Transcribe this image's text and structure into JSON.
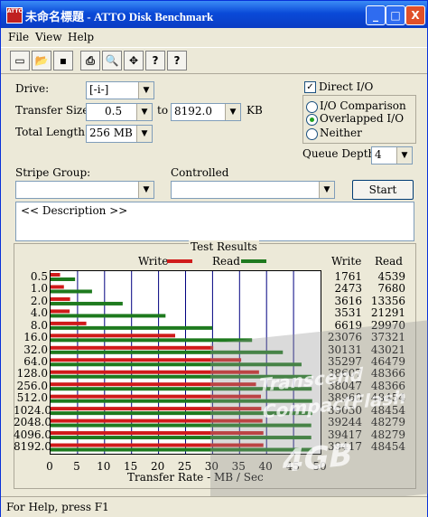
{
  "window": {
    "title": "未命名標題 - ATTO Disk Benchmark",
    "icon_label": "ATTO"
  },
  "titlebar_buttons": [
    "_",
    "□",
    "X"
  ],
  "menu": [
    "File",
    "View",
    "Help"
  ],
  "toolbar_icons": [
    "new-icon",
    "open-icon",
    "save-icon",
    "print-icon",
    "print-preview-icon",
    "move-icon",
    "help-icon",
    "context-help-icon"
  ],
  "toolbar_glyphs": [
    "▭",
    "📂",
    "▪",
    "⎙",
    "🔍",
    "✥",
    "?",
    "?"
  ],
  "form": {
    "drive_label": "Drive:",
    "drive_value": "[-i-]",
    "transfer_label": "Transfer Size:",
    "transfer_from": "0.5",
    "to_label": "to",
    "transfer_to": "8192.0",
    "kb_label": "KB",
    "length_label": "Total Length:",
    "length_value": "256 MB",
    "direct_io": "Direct I/O",
    "io_comparison": "I/O Comparison",
    "overlapped_io": "Overlapped I/O",
    "neither": "Neither",
    "queue_label": "Queue Depth:",
    "queue_value": "4",
    "stripe_label": "Stripe Group:",
    "controlled_label": "Controlled",
    "start_label": "Start",
    "description": "<< Description >>"
  },
  "results": {
    "title": "Test Results",
    "write_label": "Write",
    "read_label": "Read",
    "col_write": "Write",
    "col_read": "Read",
    "xlabel": "Transfer Rate - MB / Sec"
  },
  "status": "For Help, press F1",
  "watermark": {
    "line1": "Transcend",
    "line2": "CompactFlash",
    "line3": "4GB"
  },
  "colors": {
    "write": "#d01a1a",
    "read": "#1e7a1e",
    "grid": "#000080"
  },
  "chart_data": {
    "type": "bar",
    "orientation": "horizontal",
    "categories": [
      "0.5",
      "1.0",
      "2.0",
      "4.0",
      "8.0",
      "16.0",
      "32.0",
      "64.0",
      "128.0",
      "256.0",
      "512.0",
      "1024.0",
      "2048.0",
      "4096.0",
      "8192.0"
    ],
    "series": [
      {
        "name": "Write",
        "values": [
          1761,
          2473,
          3616,
          3531,
          6619,
          23076,
          30131,
          35297,
          38607,
          38047,
          38960,
          39030,
          39244,
          39417,
          39417
        ]
      },
      {
        "name": "Read",
        "values": [
          4539,
          7680,
          13356,
          21291,
          29970,
          37321,
          43021,
          46479,
          48366,
          48366,
          48454,
          48454,
          48279,
          48279,
          48454
        ]
      }
    ],
    "xticks": [
      "0",
      "5",
      "10",
      "15",
      "20",
      "25",
      "30",
      "35",
      "40",
      "45",
      "50"
    ],
    "xlim": [
      0,
      50
    ],
    "xlabel": "Transfer Rate - MB / Sec",
    "grid": true,
    "legend": "top"
  }
}
